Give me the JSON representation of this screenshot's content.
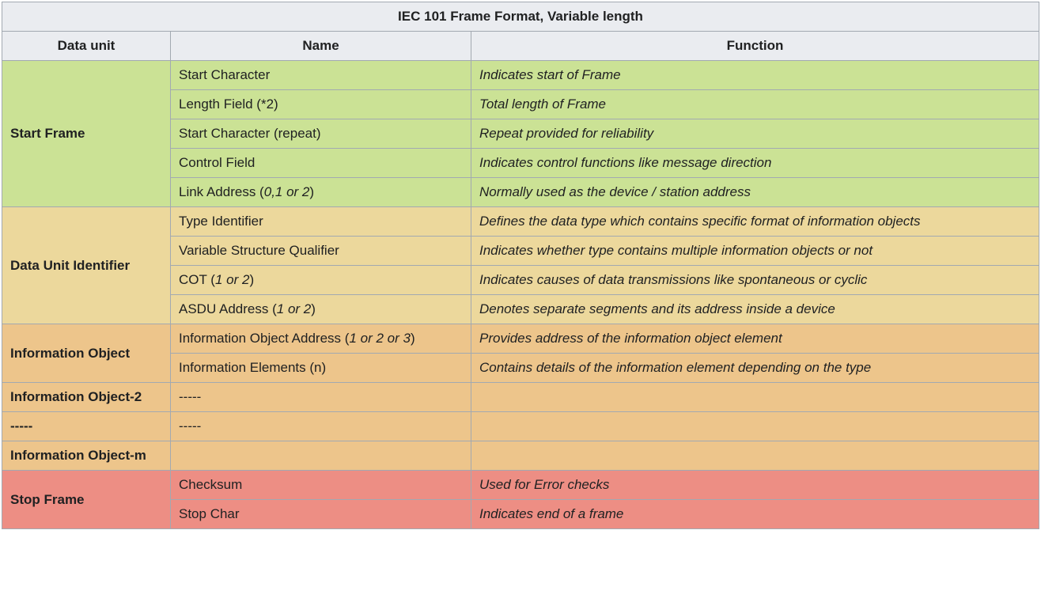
{
  "table": {
    "caption": "IEC 101 Frame Format, Variable length",
    "headers": {
      "data_unit": "Data unit",
      "name": "Name",
      "function": "Function"
    },
    "sections": [
      {
        "data_unit": "Start Frame",
        "rows": [
          {
            "name": "Start Character",
            "detail": "",
            "function": "Indicates start of Frame"
          },
          {
            "name": "Length Field (*2)",
            "detail": "",
            "function": "Total length of Frame"
          },
          {
            "name": "Start Character (repeat)",
            "detail": "",
            "function": "Repeat provided for reliability"
          },
          {
            "name": "Control Field",
            "detail": "",
            "function": "Indicates control functions like message direction"
          },
          {
            "name": "Link Address (",
            "detail": "0,1 or 2",
            "function": "Normally used as the device / station address"
          }
        ]
      },
      {
        "data_unit": "Data Unit Identifier",
        "rows": [
          {
            "name": "Type Identifier",
            "detail": "",
            "function": "Defines the data type which contains specific format of information objects"
          },
          {
            "name": "Variable Structure Qualifier",
            "detail": "",
            "function": "Indicates whether type contains multiple information objects or not"
          },
          {
            "name": "COT (",
            "detail": "1 or 2",
            "function": "Indicates causes of data transmissions like spontaneous or cyclic"
          },
          {
            "name": "ASDU Address (",
            "detail": "1 or 2",
            "function": "Denotes separate segments and its address inside a device"
          }
        ]
      },
      {
        "data_unit": "Information Object",
        "rows": [
          {
            "name": "Information Object Address (",
            "detail": "1 or 2 or 3",
            "function": "Provides address of the information object element"
          },
          {
            "name": "Information Elements (n)",
            "detail": "",
            "function": "Contains details of the information element depending on the type"
          }
        ]
      },
      {
        "data_unit": "Information Object-2",
        "rows": [
          {
            "name": "-----",
            "detail": "",
            "function": ""
          }
        ]
      },
      {
        "data_unit": "-----",
        "rows": [
          {
            "name": "-----",
            "detail": "",
            "function": ""
          }
        ]
      },
      {
        "data_unit": "Information Object-m",
        "rows": [
          {
            "name": "",
            "detail": "",
            "function": ""
          }
        ]
      },
      {
        "data_unit": "Stop Frame",
        "rows": [
          {
            "name": "Checksum",
            "detail": "",
            "function": "Used for Error checks"
          },
          {
            "name": "Stop Char",
            "detail": "",
            "function": "Indicates end of a frame"
          }
        ]
      }
    ]
  }
}
